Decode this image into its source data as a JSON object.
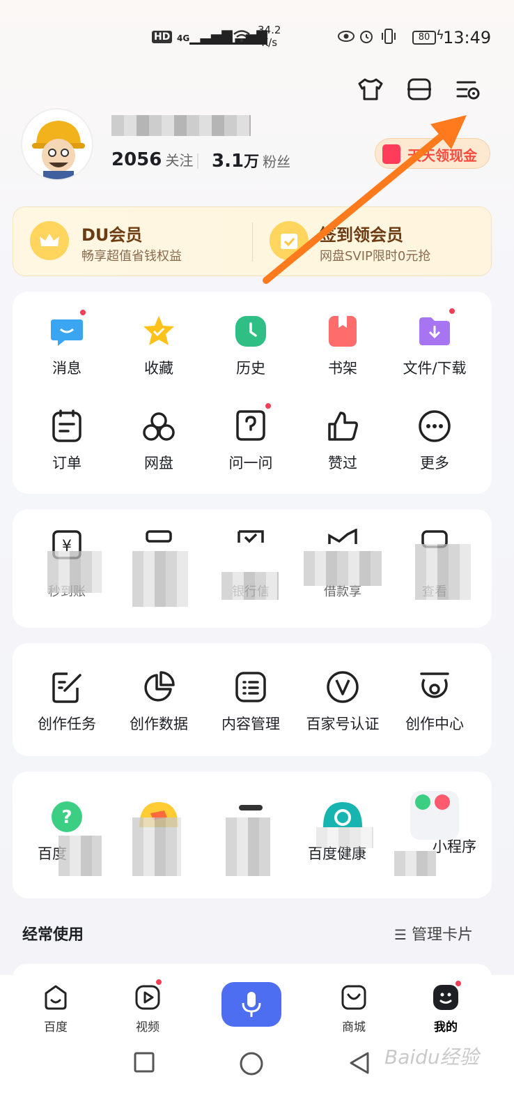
{
  "status_bar": {
    "hd": "HD",
    "net1": "4G",
    "net2": "4G",
    "speed": "34.2",
    "speed_unit": "K/s",
    "battery": "80",
    "time": "13:49"
  },
  "toolbar": {
    "skin_icon": "shirt-icon",
    "scan_icon": "scan-icon",
    "settings_icon": "settings-icon"
  },
  "profile": {
    "following_count": "2056",
    "following_label": "关注",
    "fans_count": "3.1",
    "fans_unit": "万",
    "fans_label": "粉丝",
    "daily_cash_label": "天天领现金"
  },
  "vip": {
    "left_title": "DU会员",
    "left_sub": "畅享超值省钱权益",
    "right_title": "签到领会员",
    "right_sub": "网盘SVIP限时0元抢"
  },
  "shortcuts_row1": [
    {
      "label": "消息",
      "badge": true,
      "color": "#3aa6f2"
    },
    {
      "label": "收藏",
      "badge": false,
      "color": "#ffc21a"
    },
    {
      "label": "历史",
      "badge": false,
      "color": "#2fbf85"
    },
    {
      "label": "书架",
      "badge": false,
      "color": "#ff6c6c"
    },
    {
      "label": "文件/下载",
      "badge": true,
      "color": "#a774f2"
    }
  ],
  "shortcuts_row2": [
    {
      "label": "订单",
      "badge": false
    },
    {
      "label": "网盘",
      "badge": false
    },
    {
      "label": "问一问",
      "badge": true
    },
    {
      "label": "赞过",
      "badge": false
    },
    {
      "label": "更多",
      "badge": false
    }
  ],
  "finance_row": {
    "label1": "秒到账",
    "label3": "银行信",
    "label4": "借款享",
    "label5": "查看"
  },
  "creator_row": [
    {
      "label": "创作任务"
    },
    {
      "label": "创作数据"
    },
    {
      "label": "内容管理"
    },
    {
      "label": "百家号认证"
    },
    {
      "label": "创作中心"
    }
  ],
  "apps_row": {
    "label1": "百度",
    "label4": "百度健康",
    "label5": "小程序"
  },
  "frequent": {
    "title": "经常使用",
    "manage_label": "管理卡片"
  },
  "bottom_nav": [
    {
      "label": "百度"
    },
    {
      "label": "视频",
      "badge": true
    },
    {
      "label": "商城"
    },
    {
      "label": "我的",
      "badge": true,
      "active": true
    }
  ],
  "watermark": "Baidu经验"
}
